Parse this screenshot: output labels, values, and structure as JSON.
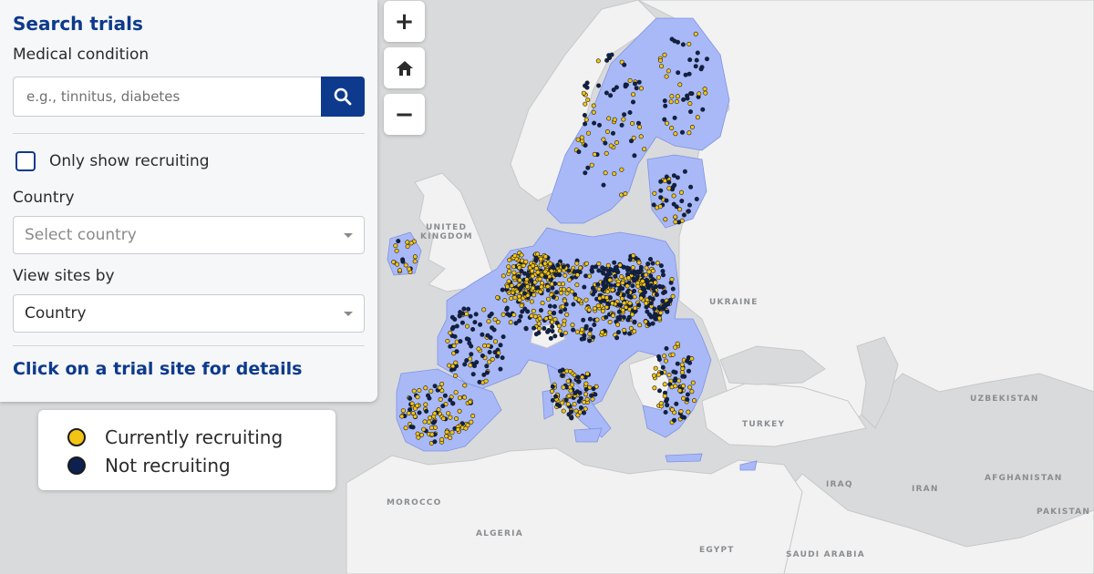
{
  "search": {
    "title": "Search trials",
    "condition_label": "Medical condition",
    "condition_placeholder": "e.g., tinnitus, diabetes",
    "recruiting_label": "Only show recruiting",
    "recruiting_checked": false,
    "country_label": "Country",
    "country_placeholder": "Select country",
    "view_label": "View sites by",
    "view_value": "Country",
    "hint": "Click on a trial site for details"
  },
  "controls": {
    "zoom_in": "+",
    "home": "home-icon",
    "zoom_out": "−"
  },
  "legend": {
    "items": [
      {
        "label": "Currently recruiting",
        "color": "#f2c413"
      },
      {
        "label": "Not recruiting",
        "color": "#0c2150"
      }
    ]
  },
  "map": {
    "colors": {
      "sea": "#d9dadb",
      "land": "#f2f2f2",
      "eu": "#a9b9f7",
      "border": "#c7c8ca",
      "eu_border": "#7e92e3"
    },
    "country_labels": [
      "UNITED KINGDOM",
      "UKRAINE",
      "TURKEY",
      "UZBEKISTAN",
      "AFGHANISTAN",
      "PAKISTAN",
      "IRAQ",
      "IRAN",
      "MOROCCO",
      "ALGERIA",
      "EGYPT",
      "SAUDI ARABIA"
    ]
  }
}
